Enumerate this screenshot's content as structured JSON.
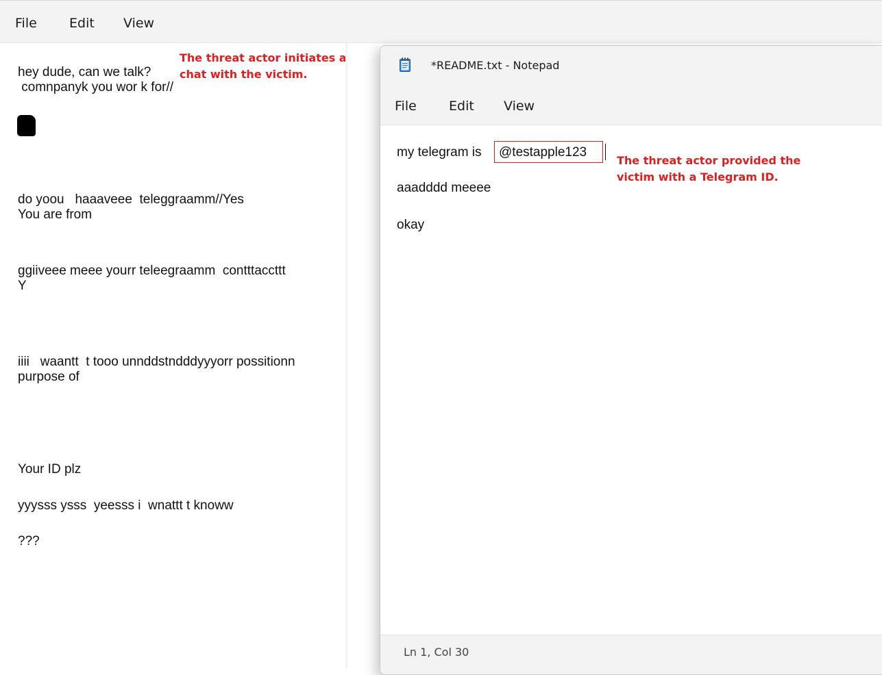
{
  "back_window": {
    "menu": {
      "file": "File",
      "edit": "Edit",
      "view": "View"
    },
    "lines": [
      "hey dude, can we talk?",
      " comnpanyk you wor k for//",
      "do yoou   haaaveee  teleggraamm//Yes",
      "You are from",
      "ggiiveee meee yourr teleegraamm  contttaccttt",
      "Y",
      "iiii   waantt  t tooo unnddstndddyyyorr possitionn",
      "purpose of",
      "Your ID plz",
      "yyysss ysss  yeesss i  wnattt t knoww",
      "???"
    ],
    "annotation": "The threat actor initiates a\nchat with the victim."
  },
  "front_window": {
    "title": "*README.txt - Notepad",
    "menu": {
      "file": "File",
      "edit": "Edit",
      "view": "View"
    },
    "lines": {
      "line1_prefix": "my telegram is",
      "handle": "@testapple123",
      "line2": "aaadddd meeee",
      "line3": "okay"
    },
    "annotation": "The threat actor provided the\nvictim with a Telegram ID.",
    "status": "Ln 1, Col 30"
  },
  "colors": {
    "annotation_red": "#e02020",
    "menubar_bg": "#f3f3f3"
  },
  "icons": {
    "notepad": "notepad-icon",
    "redaction": "redaction-mark"
  }
}
